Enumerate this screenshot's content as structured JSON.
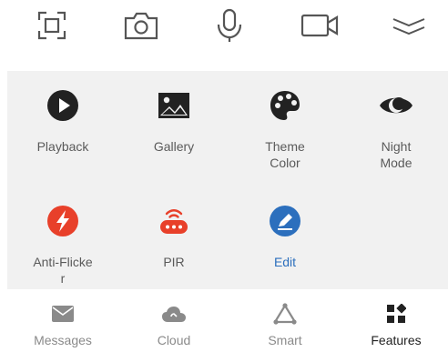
{
  "toolbar": {
    "buttons": [
      {
        "icon": "screenshot-frame-icon"
      },
      {
        "icon": "camera-icon"
      },
      {
        "icon": "microphone-icon"
      },
      {
        "icon": "video-record-icon"
      },
      {
        "icon": "collapse-chevrons-icon"
      }
    ]
  },
  "features": {
    "items": [
      {
        "label": "Playback",
        "icon": "play-circle-icon",
        "color": "#222222"
      },
      {
        "label": "Gallery",
        "icon": "image-gallery-icon",
        "color": "#222222"
      },
      {
        "label": "Theme\nColor",
        "icon": "palette-icon",
        "color": "#222222"
      },
      {
        "label": "Night\nMode",
        "icon": "night-eye-icon",
        "color": "#222222"
      },
      {
        "label": "Anti-Flicke\nr",
        "icon": "lightning-bolt-icon",
        "color": "#e8402a"
      },
      {
        "label": "PIR",
        "icon": "pir-sensor-icon",
        "color": "#e8402a"
      },
      {
        "label": "Edit",
        "icon": "edit-pen-icon",
        "color": "#2c6fbd"
      }
    ]
  },
  "bottom_nav": {
    "items": [
      {
        "label": "Messages",
        "icon": "envelope-icon"
      },
      {
        "label": "Cloud",
        "icon": "cloud-icon"
      },
      {
        "label": "Smart",
        "icon": "smart-triangle-icon"
      },
      {
        "label": "Features",
        "icon": "grid-features-icon",
        "active": true
      }
    ]
  }
}
